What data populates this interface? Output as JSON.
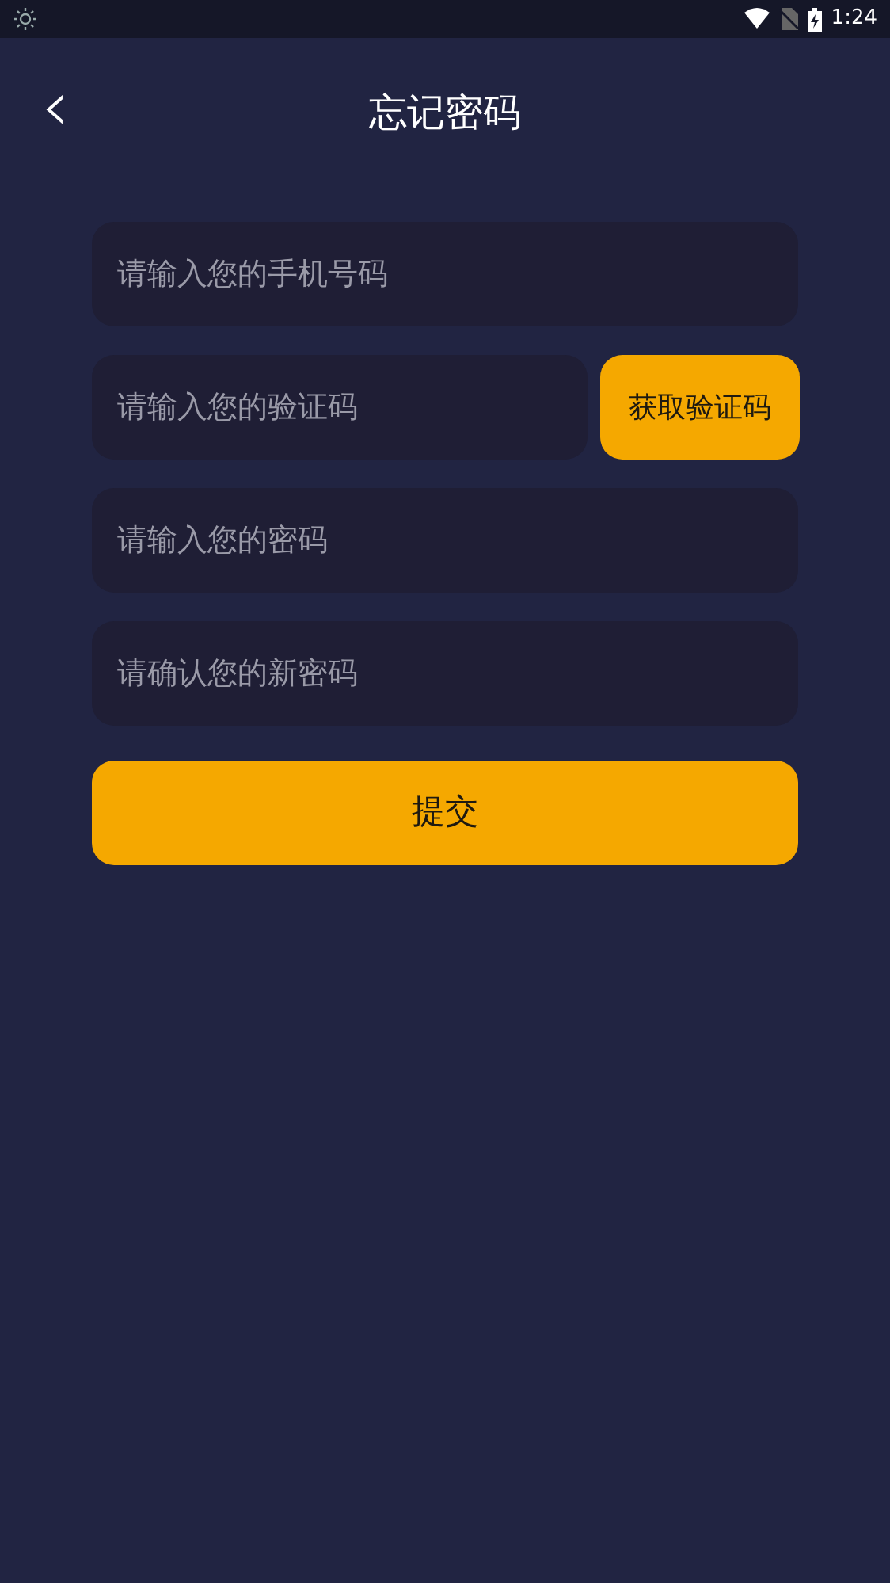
{
  "status_bar": {
    "time": "1:24"
  },
  "header": {
    "back": "‹",
    "title": "忘记密码"
  },
  "fields": [
    {
      "placeholder": "请输入您的手机号码"
    },
    {
      "placeholder": "请输入您的验证码",
      "action_button": "获取验证码"
    },
    {
      "placeholder": "请输入您的密码"
    },
    {
      "placeholder": "请确认您的新密码"
    }
  ],
  "submit_button": "提交"
}
